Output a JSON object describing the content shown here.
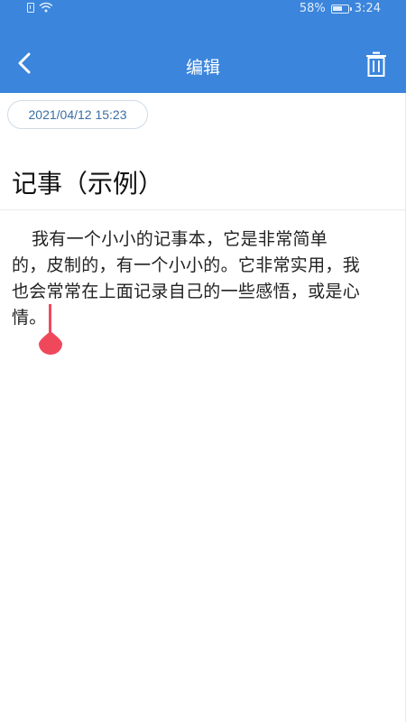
{
  "status_bar": {
    "battery_percent": "58%",
    "time": "3:24",
    "icons": [
      "sim-card-alert-icon",
      "wifi-icon",
      "battery-charging-icon"
    ]
  },
  "app_bar": {
    "title": "编辑",
    "back_icon": "chevron-left-icon",
    "delete_icon": "trash-icon",
    "background_color": "#3b85dc"
  },
  "note": {
    "date": "2021/04/12 15:23",
    "title": "记事（示例）",
    "body_lines": [
      "我有一个小小的记事本，它是非常简单",
      "的，皮制的，有一个小小的。它非常实用，我",
      "也会常常在上面记录自己的一些感悟，或是心",
      "情。"
    ]
  },
  "cursor_handle_color": "#f0485b"
}
